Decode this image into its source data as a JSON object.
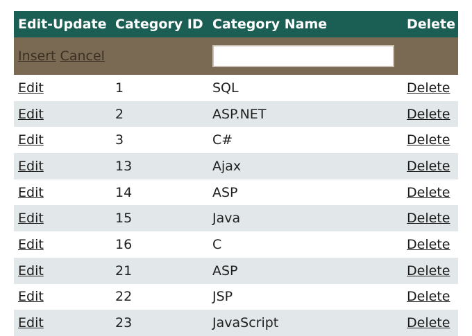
{
  "header": {
    "edit_update": "Edit-Update",
    "category_id": "Category ID",
    "category_name": "Category Name",
    "delete": "Delete"
  },
  "insert_row": {
    "insert_label": "Insert",
    "cancel_label": "Cancel",
    "name_value": ""
  },
  "rows": [
    {
      "edit": "Edit",
      "id": "1",
      "name": "SQL",
      "delete": "Delete"
    },
    {
      "edit": "Edit",
      "id": "2",
      "name": "ASP.NET",
      "delete": "Delete"
    },
    {
      "edit": "Edit",
      "id": "3",
      "name": "C#",
      "delete": "Delete"
    },
    {
      "edit": "Edit",
      "id": "13",
      "name": "Ajax",
      "delete": "Delete"
    },
    {
      "edit": "Edit",
      "id": "14",
      "name": "ASP",
      "delete": "Delete"
    },
    {
      "edit": "Edit",
      "id": "15",
      "name": "Java",
      "delete": "Delete"
    },
    {
      "edit": "Edit",
      "id": "16",
      "name": "C",
      "delete": "Delete"
    },
    {
      "edit": "Edit",
      "id": "21",
      "name": "ASP",
      "delete": "Delete"
    },
    {
      "edit": "Edit",
      "id": "22",
      "name": "JSP",
      "delete": "Delete"
    },
    {
      "edit": "Edit",
      "id": "23",
      "name": "JavaScript",
      "delete": "Delete"
    }
  ],
  "colors": {
    "header_bg": "#1b5e53",
    "insert_row_bg": "#7a6a53",
    "alt_row_bg": "#e2e8ea"
  }
}
